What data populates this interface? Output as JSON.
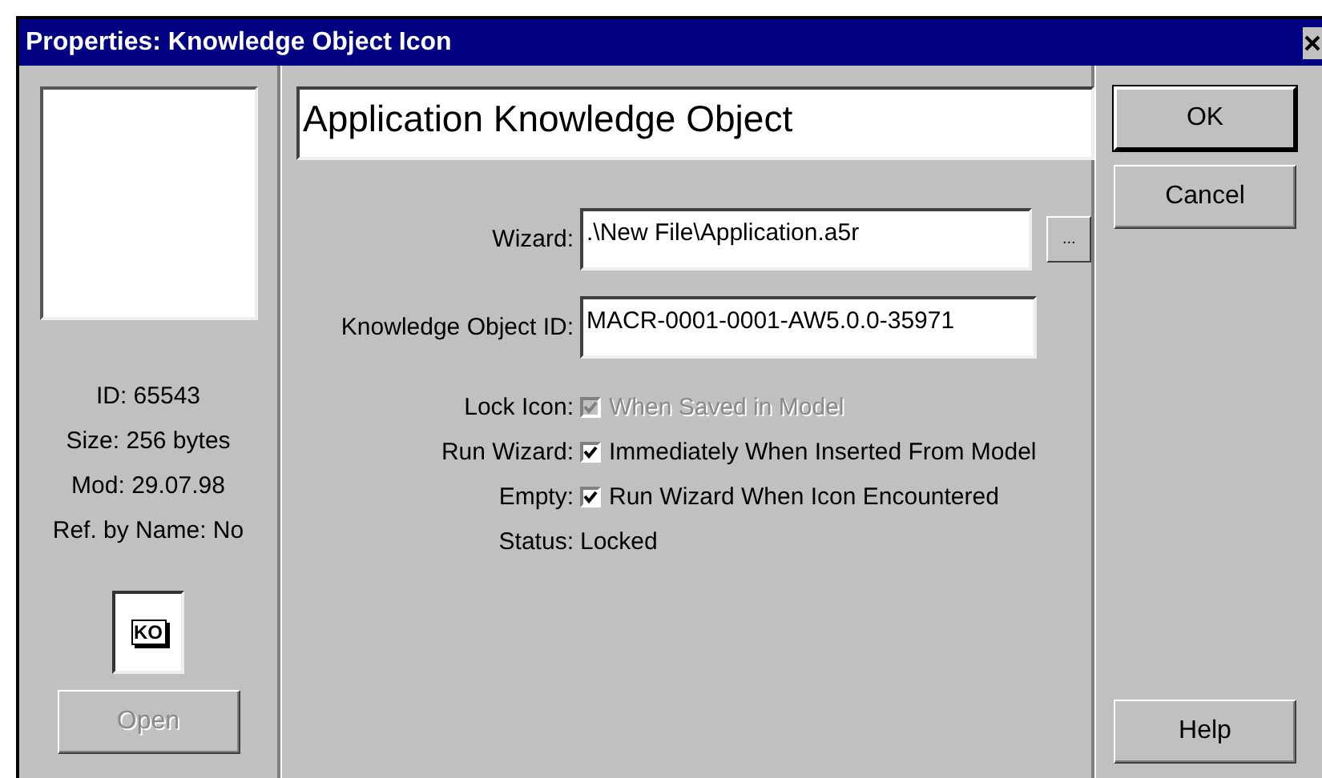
{
  "window": {
    "title": "Properties: Knowledge Object Icon"
  },
  "info": [
    {
      "label": "ID:",
      "value": "65543"
    },
    {
      "label": "Size:",
      "value": "256 bytes"
    },
    {
      "label": "Mod:",
      "value": "29.07.98"
    },
    {
      "label": "Ref. by Name:",
      "value": "No"
    }
  ],
  "icon_badge": "KO",
  "open_button": {
    "label": "Open",
    "disabled": true
  },
  "name_field": {
    "value": "Application Knowledge Object"
  },
  "wizard": {
    "label": "Wizard:",
    "value": ".\\New File\\Application.a5r",
    "browse": "..."
  },
  "object_id": {
    "label": "Knowledge Object ID:",
    "value": "MACR-0001-0001-AW5.0.0-35971"
  },
  "options": [
    {
      "label": "Lock Icon:",
      "text": "When Saved in Model",
      "checked": true,
      "disabled": true
    },
    {
      "label": "Run Wizard:",
      "text": "Immediately When Inserted From Model",
      "checked": true,
      "disabled": false
    },
    {
      "label": "Empty:",
      "text": "Run Wizard When Icon Encountered",
      "checked": true,
      "disabled": false
    }
  ],
  "status": {
    "label": "Status:",
    "value": "Locked"
  },
  "buttons": [
    {
      "label": "OK",
      "default": true
    },
    {
      "label": "Cancel",
      "default": false
    }
  ],
  "help_button": "Help"
}
